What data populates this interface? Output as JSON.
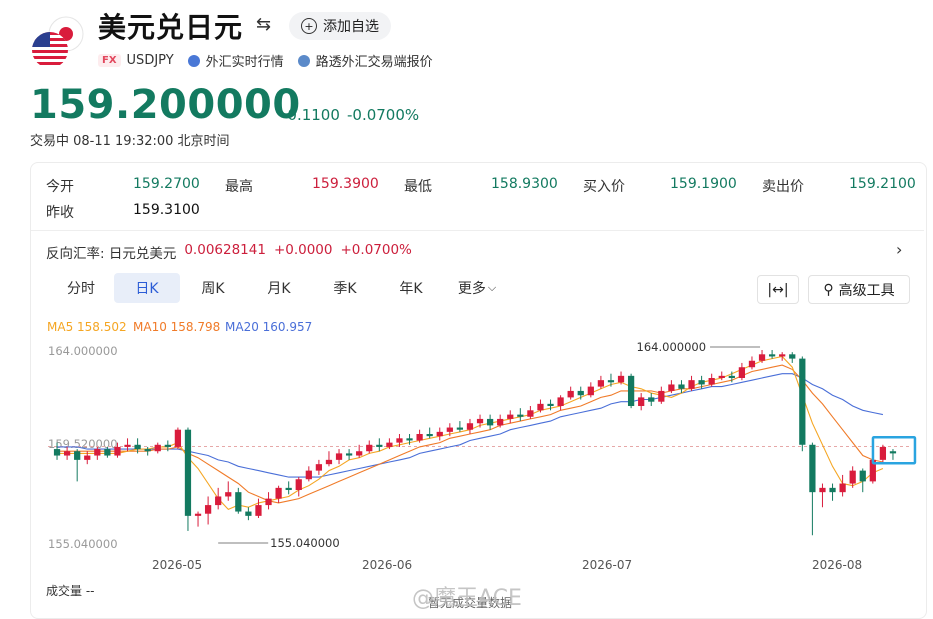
{
  "header": {
    "title": "美元兑日元",
    "add_label": "添加自选",
    "fx_badge": "FX",
    "symbol": "USDJPY",
    "realtime_label": "外汇实时行情",
    "reuters_label": "路透外汇交易端报价"
  },
  "quote": {
    "price": "159.200000",
    "change": "-0.1100",
    "change_pct": "-0.0700%",
    "status": "交易中  08-11 19:32:00  北京时间"
  },
  "stats": [
    {
      "label": "今开",
      "value": "159.2700",
      "tone": "green"
    },
    {
      "label": "最高",
      "value": "159.3900",
      "tone": "red"
    },
    {
      "label": "最低",
      "value": "158.9300",
      "tone": "green"
    },
    {
      "label": "买入价",
      "value": "159.1900",
      "tone": "green"
    },
    {
      "label": "卖出价",
      "value": "159.2100",
      "tone": "green"
    },
    {
      "label": "昨收",
      "value": "159.3100",
      "tone": "dark"
    }
  ],
  "reverse": {
    "label": "反向汇率: 日元兑美元",
    "value": "0.00628141",
    "change": "+0.0000",
    "change_pct": "+0.0700%"
  },
  "tabs": [
    "分时",
    "日K",
    "周K",
    "月K",
    "季K",
    "年K",
    "更多"
  ],
  "tools": {
    "advanced_label": "高级工具"
  },
  "chart_data": {
    "type": "candlestick",
    "ma_labels": [
      {
        "name": "MA5 158.502",
        "color": "#f5a623"
      },
      {
        "name": "MA10 158.798",
        "color": "#f07b29"
      },
      {
        "name": "MA20 160.957",
        "color": "#4a6fd8"
      }
    ],
    "y_ticks": [
      "164.000000",
      "159.520000",
      "155.040000"
    ],
    "ylim": [
      155.04,
      164.0
    ],
    "x_ticks": [
      "2026-05",
      "2026-06",
      "2026-07",
      "2026-08"
    ],
    "annotations": {
      "high": "164.000000",
      "low": "155.040000"
    },
    "ref_line": 159.52,
    "colors": {
      "up": "#d91c3c",
      "down": "#137a60"
    },
    "candles": [
      [
        159.4,
        159.1,
        159.7,
        158.9
      ],
      [
        159.1,
        159.3,
        159.5,
        158.9
      ],
      [
        159.3,
        158.9,
        159.4,
        157.9
      ],
      [
        158.9,
        159.1,
        159.3,
        158.7
      ],
      [
        159.1,
        159.4,
        159.5,
        158.9
      ],
      [
        159.4,
        159.1,
        159.5,
        159.0
      ],
      [
        159.1,
        159.5,
        159.7,
        159.0
      ],
      [
        159.5,
        159.6,
        159.9,
        159.3
      ],
      [
        159.6,
        159.4,
        159.9,
        159.2
      ],
      [
        159.4,
        159.3,
        159.5,
        159.1
      ],
      [
        159.3,
        159.6,
        159.7,
        159.2
      ],
      [
        159.6,
        159.5,
        159.8,
        159.3
      ],
      [
        159.5,
        160.3,
        160.4,
        159.4
      ],
      [
        160.3,
        156.3,
        160.4,
        155.6
      ],
      [
        156.3,
        156.4,
        156.5,
        155.8
      ],
      [
        156.4,
        156.8,
        157.2,
        155.9
      ],
      [
        156.8,
        157.2,
        157.6,
        156.6
      ],
      [
        157.2,
        157.4,
        157.9,
        157.0
      ],
      [
        157.4,
        156.5,
        157.6,
        156.4
      ],
      [
        156.5,
        156.3,
        156.7,
        156.1
      ],
      [
        156.3,
        156.8,
        157.1,
        156.2
      ],
      [
        156.8,
        157.1,
        157.4,
        156.6
      ],
      [
        157.1,
        157.6,
        157.7,
        156.9
      ],
      [
        157.6,
        157.5,
        157.9,
        157.3
      ],
      [
        157.5,
        158.0,
        158.1,
        157.2
      ],
      [
        158.0,
        158.4,
        158.6,
        157.9
      ],
      [
        158.4,
        158.7,
        158.9,
        158.2
      ],
      [
        158.7,
        158.9,
        159.3,
        158.6
      ],
      [
        158.9,
        159.2,
        159.4,
        158.7
      ],
      [
        159.2,
        159.1,
        159.4,
        158.9
      ],
      [
        159.1,
        159.3,
        159.6,
        159.0
      ],
      [
        159.3,
        159.6,
        159.8,
        159.2
      ],
      [
        159.6,
        159.5,
        159.9,
        159.3
      ],
      [
        159.5,
        159.7,
        159.9,
        159.4
      ],
      [
        159.7,
        159.9,
        160.1,
        159.5
      ],
      [
        159.9,
        159.8,
        160.1,
        159.6
      ],
      [
        159.8,
        160.1,
        160.3,
        159.7
      ],
      [
        160.1,
        160.0,
        160.4,
        159.9
      ],
      [
        160.0,
        160.2,
        160.4,
        159.8
      ],
      [
        160.2,
        160.4,
        160.6,
        160.0
      ],
      [
        160.4,
        160.3,
        160.7,
        160.2
      ],
      [
        160.3,
        160.6,
        160.8,
        160.1
      ],
      [
        160.6,
        160.8,
        161.0,
        160.4
      ],
      [
        160.8,
        160.5,
        161.0,
        160.3
      ],
      [
        160.5,
        160.8,
        161.0,
        160.4
      ],
      [
        160.8,
        161.0,
        161.2,
        160.6
      ],
      [
        161.0,
        160.9,
        161.3,
        160.7
      ],
      [
        160.9,
        161.2,
        161.4,
        160.8
      ],
      [
        161.2,
        161.5,
        161.7,
        161.1
      ],
      [
        161.5,
        161.4,
        161.7,
        161.2
      ],
      [
        161.4,
        161.8,
        161.9,
        161.2
      ],
      [
        161.8,
        162.1,
        162.3,
        161.7
      ],
      [
        162.1,
        161.9,
        162.3,
        161.7
      ],
      [
        161.9,
        162.3,
        162.5,
        161.8
      ],
      [
        162.3,
        162.6,
        162.8,
        162.2
      ],
      [
        162.6,
        162.5,
        162.9,
        162.3
      ],
      [
        162.5,
        162.8,
        163.0,
        162.4
      ],
      [
        162.8,
        161.4,
        162.9,
        161.3
      ],
      [
        161.4,
        161.8,
        162.0,
        161.2
      ],
      [
        161.8,
        161.6,
        162.0,
        161.4
      ],
      [
        161.6,
        162.1,
        162.3,
        161.5
      ],
      [
        162.1,
        162.4,
        162.6,
        162.0
      ],
      [
        162.4,
        162.2,
        162.6,
        162.0
      ],
      [
        162.2,
        162.6,
        162.8,
        162.1
      ],
      [
        162.6,
        162.4,
        162.8,
        162.2
      ],
      [
        162.4,
        162.7,
        162.9,
        162.3
      ],
      [
        162.7,
        162.8,
        163.0,
        162.6
      ],
      [
        162.8,
        162.7,
        163.0,
        162.5
      ],
      [
        162.7,
        163.2,
        163.4,
        162.6
      ],
      [
        163.2,
        163.5,
        163.7,
        163.1
      ],
      [
        163.5,
        163.8,
        164.0,
        163.4
      ],
      [
        163.8,
        163.7,
        164.0,
        163.6
      ],
      [
        163.7,
        163.8,
        163.9,
        163.5
      ],
      [
        163.8,
        163.6,
        163.9,
        163.4
      ],
      [
        163.6,
        159.6,
        163.7,
        159.3
      ],
      [
        159.6,
        157.4,
        159.7,
        155.4
      ],
      [
        157.4,
        157.6,
        157.8,
        156.7
      ],
      [
        157.6,
        157.4,
        157.8,
        157.0
      ],
      [
        157.4,
        157.8,
        158.2,
        157.2
      ],
      [
        157.8,
        158.4,
        158.6,
        157.6
      ],
      [
        158.4,
        157.9,
        158.5,
        157.4
      ],
      [
        157.9,
        158.9,
        159.2,
        157.8
      ],
      [
        158.9,
        159.5,
        159.6,
        158.7
      ],
      [
        159.3,
        159.2,
        159.4,
        158.9
      ]
    ],
    "ma5": [
      159.2,
      159.2,
      159.2,
      159.2,
      159.2,
      159.2,
      159.2,
      159.3,
      159.4,
      159.4,
      159.5,
      159.5,
      159.7,
      159.0,
      158.5,
      157.8,
      157.1,
      156.6,
      156.8,
      156.7,
      156.9,
      157.0,
      157.1,
      157.2,
      157.5,
      157.7,
      158.0,
      158.4,
      158.6,
      158.9,
      159.0,
      159.2,
      159.3,
      159.5,
      159.6,
      159.7,
      159.8,
      159.9,
      160.0,
      160.1,
      160.2,
      160.3,
      160.5,
      160.6,
      160.7,
      160.8,
      160.9,
      161.0,
      161.2,
      161.3,
      161.4,
      161.6,
      161.8,
      162.0,
      162.2,
      162.4,
      162.5,
      162.3,
      162.2,
      162.0,
      161.9,
      161.8,
      162.0,
      162.3,
      162.5,
      162.6,
      162.7,
      162.9,
      163.1,
      163.3,
      163.5,
      163.6,
      163.7,
      163.2,
      161.9,
      160.6,
      159.6,
      158.6,
      157.8,
      157.7,
      157.9,
      158.3,
      158.5
    ],
    "ma10": [
      159.3,
      159.3,
      159.3,
      159.3,
      159.3,
      159.3,
      159.3,
      159.3,
      159.3,
      159.3,
      159.4,
      159.4,
      159.5,
      159.2,
      159.0,
      158.7,
      158.4,
      158.1,
      157.8,
      157.4,
      157.2,
      157.0,
      156.9,
      157.0,
      157.1,
      157.3,
      157.5,
      157.7,
      157.9,
      158.1,
      158.3,
      158.5,
      158.7,
      158.9,
      159.1,
      159.3,
      159.5,
      159.6,
      159.7,
      159.9,
      160.0,
      160.1,
      160.2,
      160.3,
      160.5,
      160.6,
      160.7,
      160.8,
      160.9,
      161.0,
      161.2,
      161.3,
      161.4,
      161.6,
      161.8,
      161.9,
      162.1,
      162.1,
      162.1,
      162.1,
      162.0,
      162.1,
      162.2,
      162.2,
      162.3,
      162.4,
      162.5,
      162.6,
      162.8,
      163.0,
      163.1,
      163.2,
      163.3,
      163.1,
      162.6,
      162.0,
      161.5,
      160.9,
      160.3,
      159.7,
      159.1,
      158.9,
      158.8
    ],
    "ma20": [
      159.5,
      159.5,
      159.5,
      159.4,
      159.4,
      159.4,
      159.4,
      159.4,
      159.4,
      159.4,
      159.4,
      159.4,
      159.4,
      159.3,
      159.2,
      159.1,
      158.9,
      158.8,
      158.6,
      158.5,
      158.4,
      158.3,
      158.2,
      158.1,
      158.1,
      158.1,
      158.1,
      158.2,
      158.3,
      158.4,
      158.5,
      158.6,
      158.7,
      158.8,
      158.9,
      159.0,
      159.2,
      159.3,
      159.4,
      159.5,
      159.6,
      159.8,
      159.9,
      160.0,
      160.1,
      160.3,
      160.4,
      160.5,
      160.6,
      160.7,
      160.9,
      161.0,
      161.1,
      161.2,
      161.3,
      161.5,
      161.6,
      161.6,
      161.7,
      161.7,
      161.8,
      161.9,
      162.0,
      162.1,
      162.2,
      162.3,
      162.3,
      162.4,
      162.5,
      162.6,
      162.7,
      162.8,
      162.9,
      162.9,
      162.7,
      162.4,
      162.2,
      161.9,
      161.7,
      161.4,
      161.2,
      161.1,
      161.0
    ]
  },
  "volume": {
    "label": "成交量 --",
    "empty": "暂无成交量数据"
  },
  "watermark": "@魔王ACE"
}
